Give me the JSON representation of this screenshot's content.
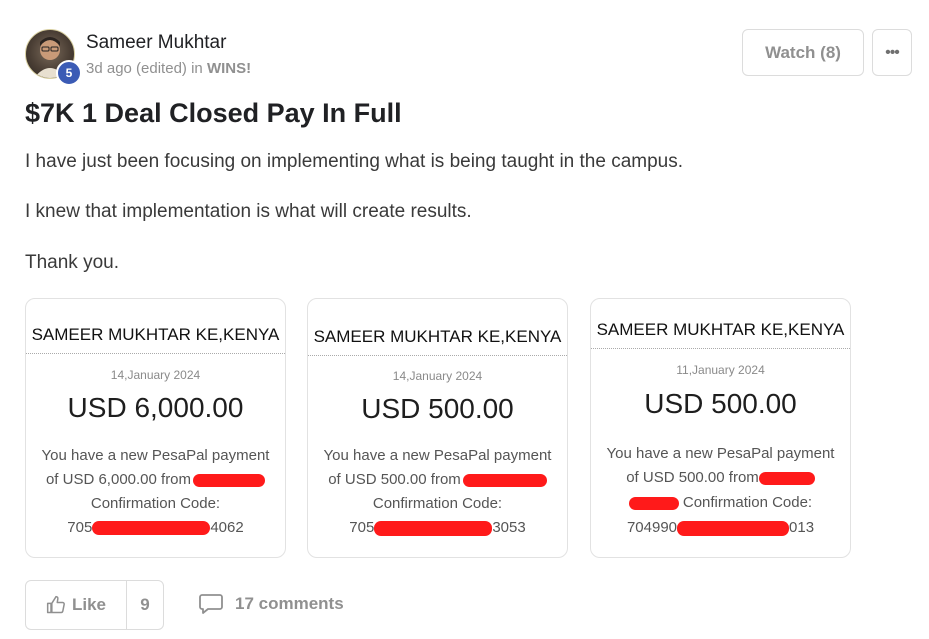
{
  "author": {
    "name": "Sameer Mukhtar",
    "level": "5",
    "time": "3d ago (edited)",
    "in_word": "in",
    "group": "WINS!"
  },
  "actions": {
    "watch": "Watch (8)",
    "more": "•••"
  },
  "post": {
    "title": "$7K 1 Deal Closed Pay In Full",
    "paragraphs": [
      "I have just been focusing on implementing what is being taught in the campus.",
      "I knew that implementation is what will create results.",
      "Thank you."
    ]
  },
  "receipts": [
    {
      "header": "SAMEER MUKHTAR KE,KENYA",
      "date": "14,January 2024",
      "amount": "USD 6,000.00",
      "line1": "You have a new PesaPal payment",
      "line2": "of USD 6,000.00 from",
      "line3": "Confirmation Code:",
      "code_start": "705",
      "code_end": "4062"
    },
    {
      "header": "SAMEER MUKHTAR KE,KENYA",
      "date": "14,January 2024",
      "amount": "USD 500.00",
      "line1": "You have a new PesaPal payment",
      "line2": "of USD 500.00 from",
      "line3": "Confirmation Code:",
      "code_start": "705",
      "code_end": "3053"
    },
    {
      "header": "SAMEER MUKHTAR KE,KENYA",
      "date": "11,January 2024",
      "amount": "USD 500.00",
      "line1": "You have a new PesaPal payment",
      "line2": "of USD 500.00 from",
      "line3": "Confirmation Code:",
      "code_start": "704990",
      "code_end": "013"
    }
  ],
  "footer": {
    "like": "Like",
    "like_count": "9",
    "comments": "17 comments"
  },
  "colors": {
    "badge": "#3b5bb5",
    "redaction": "#ff1a1a",
    "muted": "#909090"
  }
}
